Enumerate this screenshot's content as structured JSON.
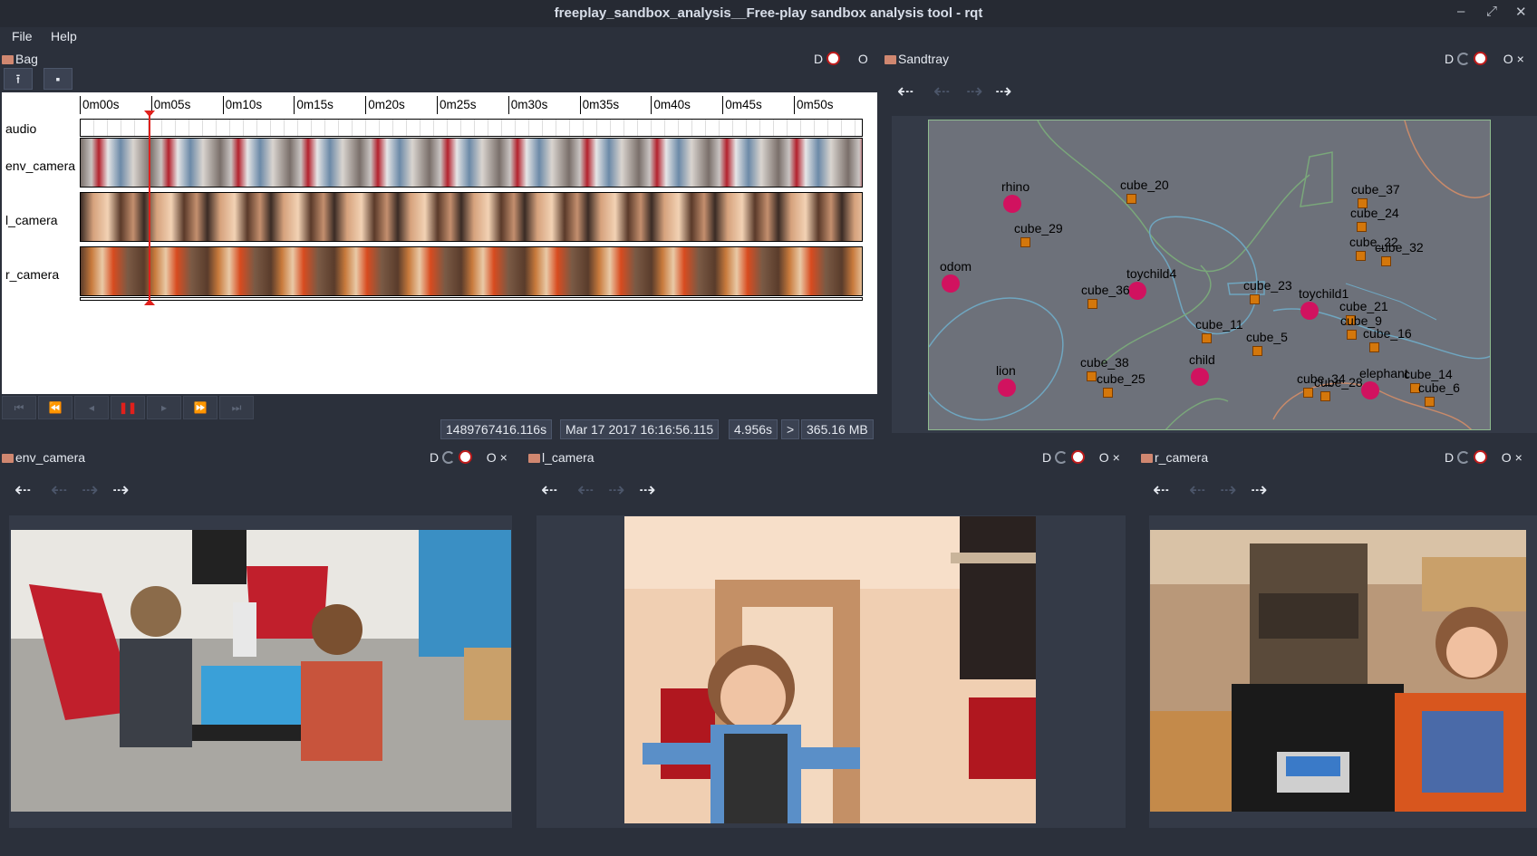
{
  "window": {
    "title": "freeplay_sandbox_analysis__Free-play sandbox analysis tool - rqt"
  },
  "menu": {
    "file": "File",
    "help": "Help"
  },
  "bag_panel": {
    "title": "Bag",
    "ctl_d": "D",
    "ctl_o": "O",
    "timeline_ticks": [
      "0m00s",
      "0m05s",
      "0m10s",
      "0m15s",
      "0m20s",
      "0m25s",
      "0m30s",
      "0m35s",
      "0m40s",
      "0m45s",
      "0m50s"
    ],
    "tracks": [
      "audio",
      "env_camera",
      "l_camera",
      "r_camera"
    ],
    "playhead_fraction": 0.089,
    "status": {
      "stamp": "1489767416.116s",
      "date": "Mar 17 2017 16:16:56.115",
      "elapsed": "4.956s",
      "rate": ">",
      "size": "365.16 MB"
    }
  },
  "sandtray_panel": {
    "title": "Sandtray",
    "ctl_d": "D",
    "ctl_o": "O",
    "colors": {
      "frame": "#8fbc8f",
      "field": "#6d717a",
      "marker": "#d1125f",
      "cube": "#d4770b"
    },
    "markers": [
      {
        "label": "rhino",
        "type": "circle"
      },
      {
        "label": "odom",
        "type": "circle"
      },
      {
        "label": "toychild4",
        "type": "circle"
      },
      {
        "label": "toychild1",
        "type": "circle"
      },
      {
        "label": "lion",
        "type": "circle"
      },
      {
        "label": "child",
        "type": "circle"
      },
      {
        "label": "elephant",
        "type": "circle"
      },
      {
        "label": "cube_20",
        "type": "square"
      },
      {
        "label": "cube_29",
        "type": "square"
      },
      {
        "label": "cube_36",
        "type": "square"
      },
      {
        "label": "cube_23",
        "type": "square"
      },
      {
        "label": "cube_11",
        "type": "square"
      },
      {
        "label": "cube_5",
        "type": "square"
      },
      {
        "label": "cube_38",
        "type": "square"
      },
      {
        "label": "cube_25",
        "type": "square"
      },
      {
        "label": "cube_34",
        "type": "square"
      },
      {
        "label": "cube_28",
        "type": "square"
      },
      {
        "label": "cube_37",
        "type": "square"
      },
      {
        "label": "cube_24",
        "type": "square"
      },
      {
        "label": "cube_22",
        "type": "square"
      },
      {
        "label": "cube_32",
        "type": "square"
      },
      {
        "label": "cube_21",
        "type": "square"
      },
      {
        "label": "cube_9",
        "type": "square"
      },
      {
        "label": "cube_16",
        "type": "square"
      },
      {
        "label": "cube_14",
        "type": "square"
      },
      {
        "label": "cube_6",
        "type": "square"
      }
    ]
  },
  "camera_panels": {
    "env": {
      "title": "env_camera",
      "ctl_d": "D",
      "ctl_o": "O"
    },
    "left": {
      "title": "l_camera",
      "ctl_d": "D",
      "ctl_o": "O"
    },
    "right": {
      "title": "r_camera",
      "ctl_d": "D",
      "ctl_o": "O"
    }
  }
}
